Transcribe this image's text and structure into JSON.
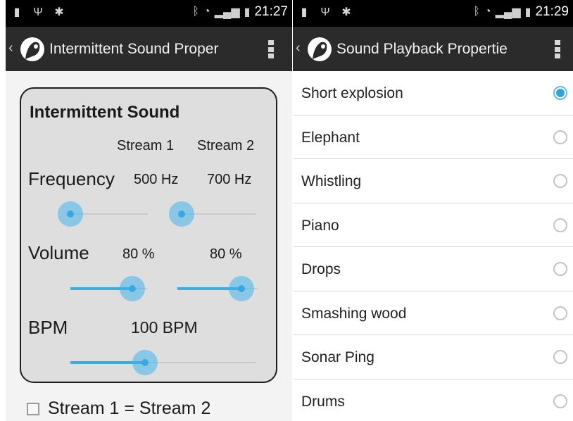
{
  "left": {
    "status": {
      "time": "21:27"
    },
    "actionbar": {
      "title": "Intermittent Sound Proper"
    },
    "card": {
      "title": "Intermittent Sound",
      "stream1_header": "Stream 1",
      "stream2_header": "Stream 2",
      "frequency": {
        "label": "Frequency",
        "stream1": "500 Hz",
        "stream2": "700 Hz",
        "stream1_level": 0.0,
        "stream2_level": 0.0
      },
      "volume": {
        "label": "Volume",
        "stream1": "80 %",
        "stream2": "80 %",
        "stream1_level": 0.8,
        "stream2_level": 0.8
      },
      "bpm": {
        "label": "BPM",
        "value": "100 BPM",
        "level": 0.4
      }
    },
    "checkbox": {
      "label": "Stream 1 = Stream 2",
      "checked": false
    }
  },
  "right": {
    "status": {
      "time": "21:29"
    },
    "actionbar": {
      "title": "Sound Playback Propertie"
    },
    "items": [
      {
        "label": "Short explosion",
        "selected": true
      },
      {
        "label": "Elephant",
        "selected": false
      },
      {
        "label": "Whistling",
        "selected": false
      },
      {
        "label": "Piano",
        "selected": false
      },
      {
        "label": "Drops",
        "selected": false
      },
      {
        "label": "Smashing wood",
        "selected": false
      },
      {
        "label": "Sonar Ping",
        "selected": false
      },
      {
        "label": "Drums",
        "selected": false
      }
    ]
  },
  "icons": {
    "status_left": [
      "battery-100-icon",
      "usb-icon",
      "debug-bug-icon"
    ],
    "status_right": [
      "bluetooth-icon",
      "wifi-icon",
      "signal-icon",
      "battery-charging-icon"
    ],
    "actionbar": [
      "up-chevron-icon",
      "app-logo-icon",
      "overflow-menu-icon"
    ]
  },
  "colors": {
    "accent": "#2fa4dc",
    "actionbar": "#2b2b2b",
    "statusbar": "#000000",
    "card_bg": "#dedede"
  }
}
